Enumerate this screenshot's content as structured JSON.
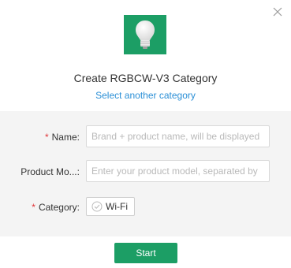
{
  "dialog": {
    "title": "Create RGBCW-V3 Category",
    "select_link": "Select another category"
  },
  "form": {
    "name": {
      "label": "Name",
      "colon": ":",
      "required": "*",
      "placeholder": "Brand + product name, will be displayed"
    },
    "model": {
      "label": "Product Mo...",
      "colon": ":",
      "placeholder": "Enter your product model, separated by"
    },
    "category": {
      "label": "Category",
      "colon": ":",
      "required": "*",
      "selected": "Wi-Fi"
    }
  },
  "footer": {
    "start_label": "Start"
  },
  "colors": {
    "accent": "#1c9e65",
    "link": "#2a8fd6",
    "required": "#e0363a"
  },
  "icons": {
    "close": "close-icon",
    "product": "bulb-icon",
    "chip": "check-circle-icon"
  }
}
